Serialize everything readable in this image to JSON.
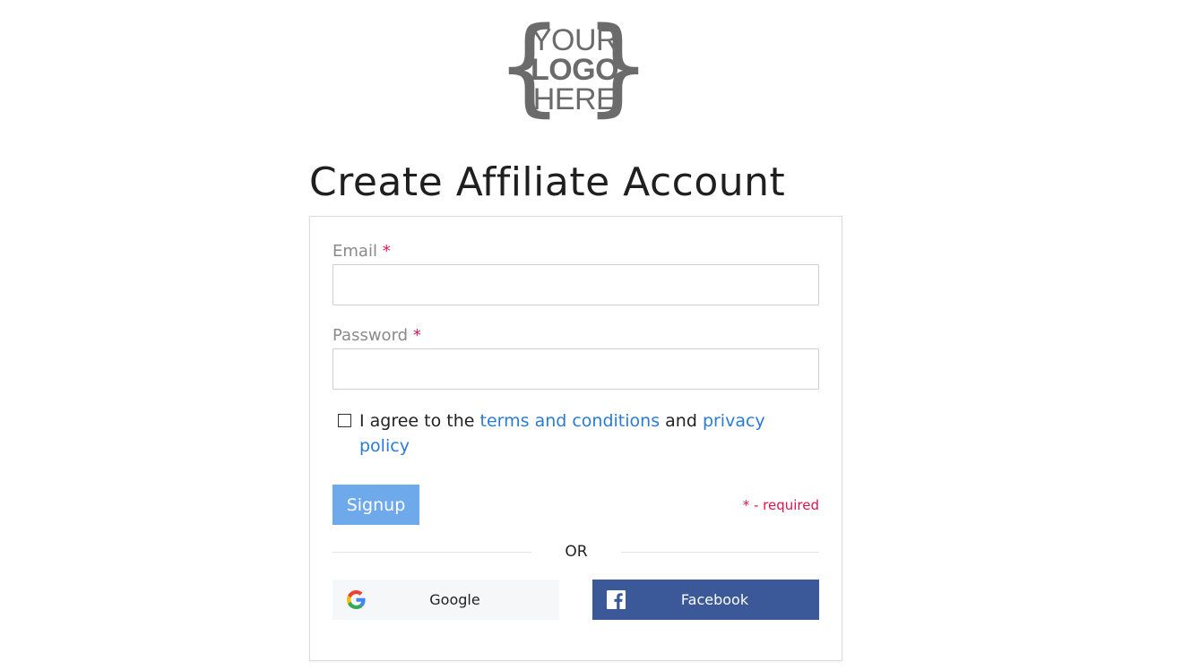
{
  "logo": {
    "line1": "YOUR",
    "line2": "LOGO",
    "line3": "HERE",
    "color": "#6b6b6b"
  },
  "page_title": "Create Affiliate Account",
  "form": {
    "email": {
      "label": "Email",
      "required_mark": "*",
      "value": "",
      "placeholder": ""
    },
    "password": {
      "label": "Password",
      "required_mark": "*",
      "value": "",
      "placeholder": ""
    },
    "agree": {
      "checked": false,
      "prefix": "I agree to the ",
      "terms_link": "terms and conditions",
      "middle": " and ",
      "privacy_link": "privacy policy"
    },
    "signup_label": "Signup",
    "required_note": "* - required",
    "or_label": "OR"
  },
  "social": {
    "google_label": "Google",
    "google_icon": "google-g-icon",
    "facebook_label": "Facebook",
    "facebook_icon": "facebook-f-icon"
  },
  "colors": {
    "accent_link": "#2b7bd6",
    "signup_bg": "#6ea9ec",
    "required": "#e0144c",
    "facebook_bg": "#3b5998",
    "google_bg": "#f6f7f9"
  }
}
